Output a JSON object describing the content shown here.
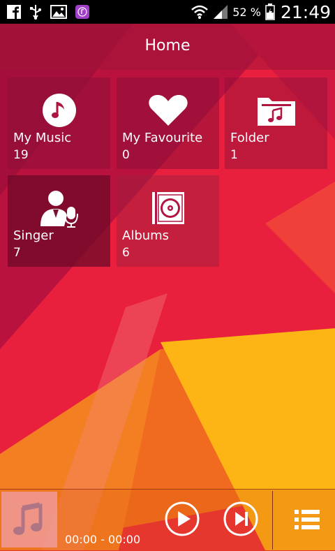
{
  "status_bar": {
    "battery_percent": "52 %",
    "time": "21:49",
    "left_icons": [
      "facebook-icon",
      "usb-icon",
      "image-icon",
      "music-app-icon"
    ],
    "right_icons": [
      "wifi-icon",
      "signal-icon",
      "battery-icon"
    ]
  },
  "header": {
    "title": "Home"
  },
  "tiles": [
    {
      "label": "My Music",
      "count": "19",
      "icon": "music-note-icon"
    },
    {
      "label": "My Favourite",
      "count": "0",
      "icon": "heart-icon"
    },
    {
      "label": "Folder",
      "count": "1",
      "icon": "music-folder-icon"
    },
    {
      "label": "Singer",
      "count": "7",
      "icon": "singer-icon"
    },
    {
      "label": "Albums",
      "count": "6",
      "icon": "album-icon"
    }
  ],
  "player": {
    "time": "00:00 - 00:00",
    "icons": [
      "album-art-placeholder-icon",
      "play-icon",
      "next-icon",
      "playlist-icon"
    ]
  },
  "colors": {
    "primary": "#e8203e",
    "crimson": "#a01440",
    "orange": "#f58220",
    "yellow": "#fdb515",
    "status_bar": "#000000"
  }
}
